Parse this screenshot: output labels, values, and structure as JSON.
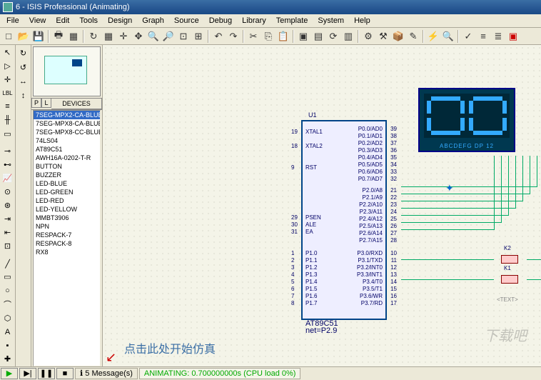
{
  "window": {
    "title": "6 - ISIS Professional (Animating)"
  },
  "menu": [
    "File",
    "View",
    "Edit",
    "Tools",
    "Design",
    "Graph",
    "Source",
    "Debug",
    "Library",
    "Template",
    "System",
    "Help"
  ],
  "devices": {
    "header_p": "P",
    "header_l": "L",
    "header_label": "DEVICES",
    "items": [
      "7SEG-MPX2-CA-BLUE",
      "7SEG-MPX8-CA-BLUE",
      "7SEG-MPX8-CC-BLUE",
      "74LS04",
      "AT89C51",
      "AWH16A-0202-T-R",
      "BUTTON",
      "BUZZER",
      "LED-BLUE",
      "LED-GREEN",
      "LED-RED",
      "LED-YELLOW",
      "MMBT3906",
      "NPN",
      "RESPACK-7",
      "RESPACK-8",
      "RX8"
    ],
    "selected": 0
  },
  "chip": {
    "ref": "U1",
    "name": "AT89C51",
    "net": "net=P2.9",
    "pins_left": [
      {
        "num": "19",
        "name": "XTAL1"
      },
      {
        "num": "18",
        "name": "XTAL2"
      },
      {
        "num": "9",
        "name": "RST"
      },
      {
        "num": "29",
        "name": "PSEN"
      },
      {
        "num": "30",
        "name": "ALE"
      },
      {
        "num": "31",
        "name": "EA"
      },
      {
        "num": "1",
        "name": "P1.0"
      },
      {
        "num": "2",
        "name": "P1.1"
      },
      {
        "num": "3",
        "name": "P1.2"
      },
      {
        "num": "4",
        "name": "P1.3"
      },
      {
        "num": "5",
        "name": "P1.4"
      },
      {
        "num": "6",
        "name": "P1.5"
      },
      {
        "num": "7",
        "name": "P1.6"
      },
      {
        "num": "8",
        "name": "P1.7"
      }
    ],
    "pins_right": [
      {
        "num": "39",
        "name": "P0.0/AD0"
      },
      {
        "num": "38",
        "name": "P0.1/AD1"
      },
      {
        "num": "37",
        "name": "P0.2/AD2"
      },
      {
        "num": "36",
        "name": "P0.3/AD3"
      },
      {
        "num": "35",
        "name": "P0.4/AD4"
      },
      {
        "num": "34",
        "name": "P0.5/AD5"
      },
      {
        "num": "33",
        "name": "P0.6/AD6"
      },
      {
        "num": "32",
        "name": "P0.7/AD7"
      },
      {
        "num": "21",
        "name": "P2.0/A8"
      },
      {
        "num": "22",
        "name": "P2.1/A9"
      },
      {
        "num": "23",
        "name": "P2.2/A10"
      },
      {
        "num": "24",
        "name": "P2.3/A11"
      },
      {
        "num": "25",
        "name": "P2.4/A12"
      },
      {
        "num": "26",
        "name": "P2.5/A13"
      },
      {
        "num": "27",
        "name": "P2.6/A14"
      },
      {
        "num": "28",
        "name": "P2.7/A15"
      },
      {
        "num": "10",
        "name": "P3.0/RXD"
      },
      {
        "num": "11",
        "name": "P3.1/TXD"
      },
      {
        "num": "12",
        "name": "P3.2/INT0"
      },
      {
        "num": "13",
        "name": "P3.3/INT1"
      },
      {
        "num": "14",
        "name": "P3.4/T0"
      },
      {
        "num": "15",
        "name": "P3.5/T1"
      },
      {
        "num": "16",
        "name": "P3.6/WR"
      },
      {
        "num": "17",
        "name": "P3.7/RD"
      }
    ]
  },
  "display": {
    "value": "00",
    "label": "ABCDEFG DP   12"
  },
  "switches": {
    "k1": "K1",
    "k2": "K2",
    "text": "<TEXT>"
  },
  "annotation": "点击此处开始仿真",
  "status": {
    "messages_count": "5",
    "messages_label": "Message(s)",
    "anim": "ANIMATING: 0.700000000s (CPU load 0%)"
  },
  "watermark": "下载吧"
}
